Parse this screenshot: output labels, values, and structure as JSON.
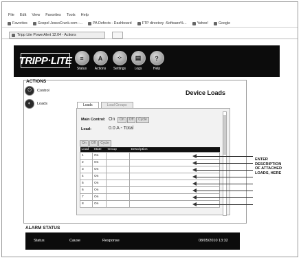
{
  "browser": {
    "menu": [
      "File",
      "Edit",
      "View",
      "Favorites",
      "Tools",
      "Help"
    ],
    "favorites": [
      "Favorites",
      "Gospel JessoCrunk.com -...",
      "PA Defects - Dashboard",
      "FTP directory -Software%...",
      "Yahoo!",
      "Google"
    ],
    "tab_title": "Tripp Lite PowerAlert 12.04 - Actions"
  },
  "app": {
    "logo": "TRIPP·LITE",
    "nav": [
      {
        "label": "Status",
        "icon": "status-icon"
      },
      {
        "label": "Actions",
        "icon": "actions-icon"
      },
      {
        "label": "Settings",
        "icon": "settings-icon"
      },
      {
        "label": "Logs",
        "icon": "logs-icon"
      },
      {
        "label": "Help",
        "icon": "help-icon"
      }
    ]
  },
  "section_title": "ACTIONS",
  "sidebar": [
    {
      "label": "Control",
      "icon": "control-icon"
    },
    {
      "label": "Loads",
      "icon": "loads-icon"
    }
  ],
  "page_title": "Device Loads",
  "tabs": [
    "Loads",
    "Load Groups"
  ],
  "main_control": {
    "label": "Main Control:",
    "value": "On",
    "buttons": [
      "On",
      "Off",
      "Cycle"
    ]
  },
  "load": {
    "label": "Load:",
    "value": "0.0 A - Total"
  },
  "table_buttons": [
    "On",
    "Off",
    "Cycle"
  ],
  "table": {
    "headers": [
      "Load",
      "State",
      "Group",
      "Description"
    ],
    "rows": [
      {
        "load": "1",
        "state": "On",
        "group": "",
        "desc": ""
      },
      {
        "load": "2",
        "state": "On",
        "group": "",
        "desc": ""
      },
      {
        "load": "3",
        "state": "On",
        "group": "",
        "desc": ""
      },
      {
        "load": "4",
        "state": "On",
        "group": "",
        "desc": ""
      },
      {
        "load": "5",
        "state": "On",
        "group": "",
        "desc": ""
      },
      {
        "load": "6",
        "state": "On",
        "group": "",
        "desc": ""
      },
      {
        "load": "7",
        "state": "On",
        "group": "",
        "desc": ""
      },
      {
        "load": "8",
        "state": "On",
        "group": "",
        "desc": ""
      }
    ]
  },
  "annotation": [
    "ENTER",
    "DESCRIPTION",
    "OF ATTACHED",
    "LOADS, HERE"
  ],
  "alarm": {
    "title": "ALARM STATUS",
    "headers": [
      "Status",
      "Cause",
      "Response"
    ],
    "timestamp": "08/05/2010 13:32"
  }
}
